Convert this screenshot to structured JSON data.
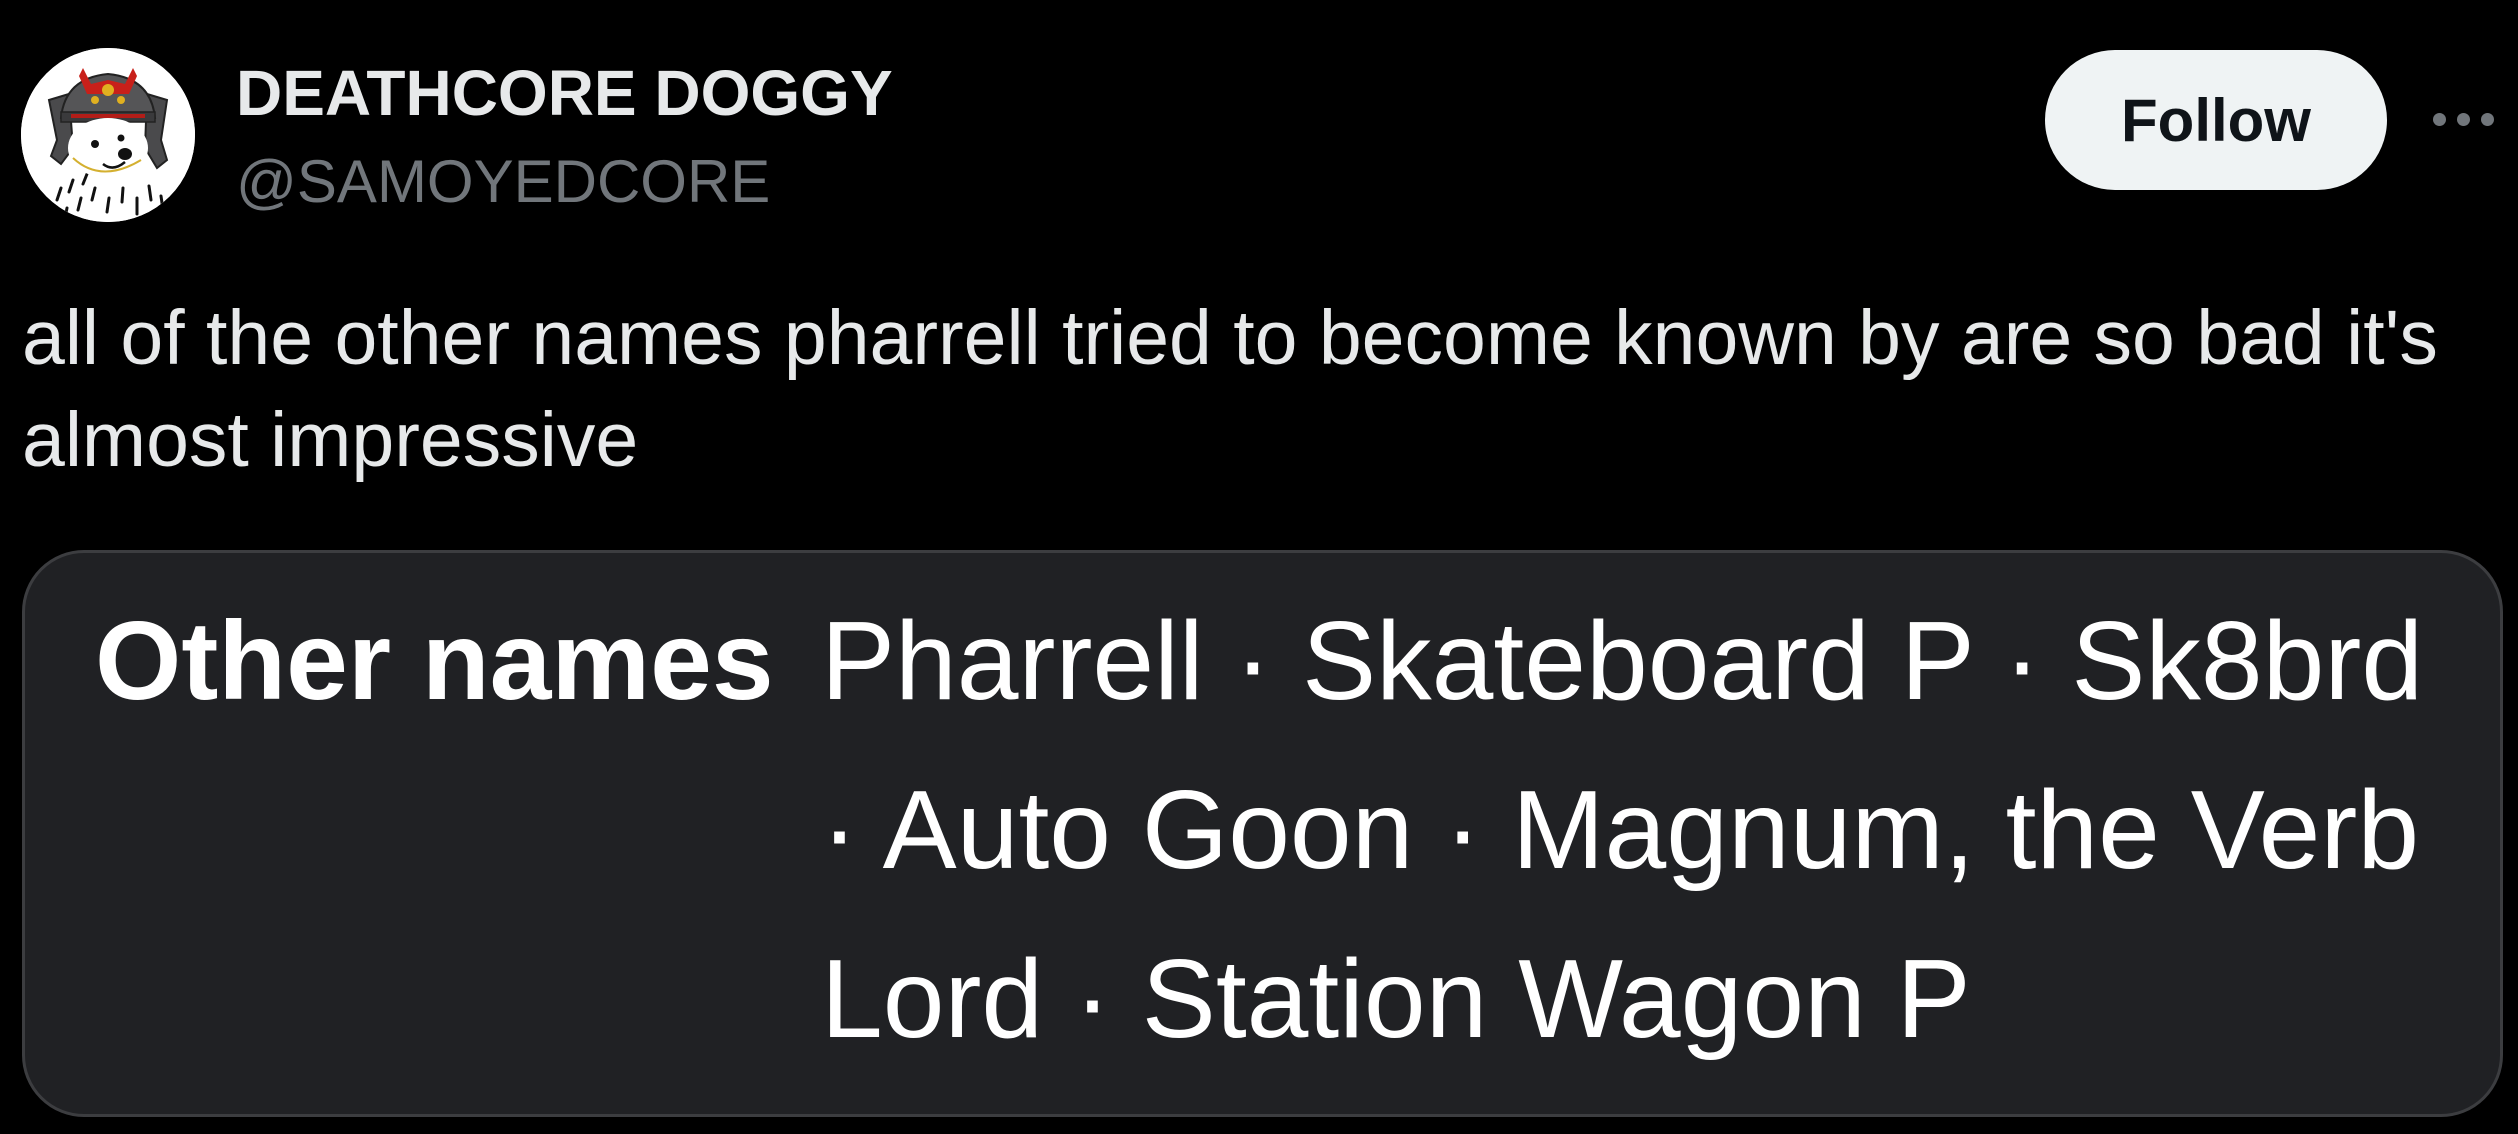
{
  "post": {
    "author": {
      "display_name": "DEATHCORE DOGGY",
      "handle": "@SAMOYEDCORE",
      "avatar_icon": "samoyed-samurai-avatar"
    },
    "actions": {
      "follow_label": "Follow",
      "more_icon": "more-horizontal-icon"
    },
    "text": "all of the other names pharrell tried to become known by are so bad it's almost impressive",
    "embedded_image": {
      "label": "Other names",
      "value_lines": [
        "Pharrell · Skateboard P · Sk8brd",
        "· Auto Goon · Magnum, the Verb",
        "Lord · Station Wagon P"
      ]
    }
  },
  "colors": {
    "background": "#000000",
    "primary_text": "#e7e9ea",
    "secondary_text": "#71767b",
    "follow_button_bg": "#eff3f4",
    "follow_button_text": "#0f1419",
    "card_bg": "#202124",
    "card_border": "#3c3d40"
  }
}
